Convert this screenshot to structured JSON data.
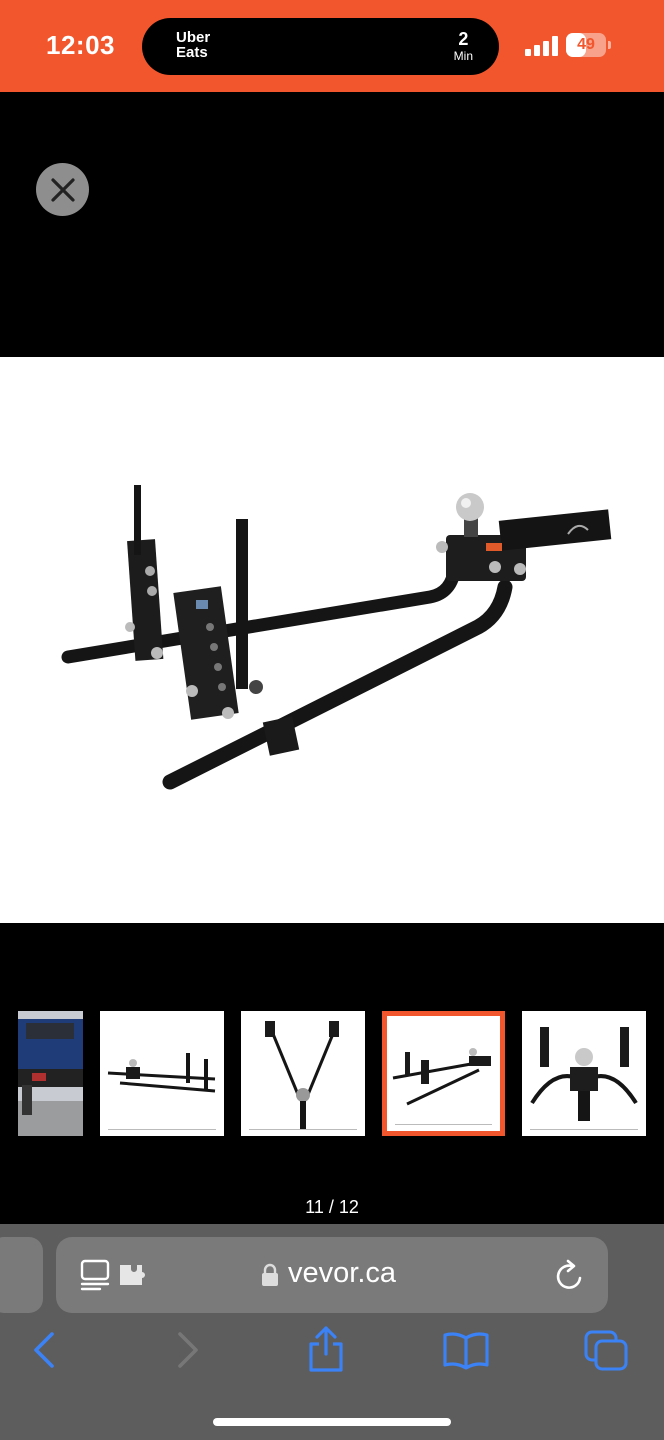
{
  "status_bar": {
    "time": "12:03",
    "live_activity": {
      "brand_line1": "Uber",
      "brand_line2": "Eats",
      "count": "2",
      "unit": "Min"
    },
    "battery": "49",
    "battery_level": 0.49,
    "accent_color": "#f2562d"
  },
  "viewer": {
    "close_icon": "close-icon",
    "counter": "11 / 12",
    "main_image": "weight-distribution-hitch-photo",
    "thumbnails": [
      {
        "icon": "truck-rear-photo",
        "selected": false
      },
      {
        "icon": "hitch-side-view",
        "selected": false
      },
      {
        "icon": "hitch-v-view",
        "selected": false
      },
      {
        "icon": "hitch-angled-view",
        "selected": true
      },
      {
        "icon": "hitch-front-view",
        "selected": false
      }
    ]
  },
  "browser": {
    "url": "vevor.ca",
    "icons": [
      "reader-icon",
      "extension-icon",
      "lock-icon",
      "reload-icon",
      "back-icon",
      "forward-icon",
      "share-icon",
      "bookmarks-icon",
      "tabs-icon"
    ]
  }
}
